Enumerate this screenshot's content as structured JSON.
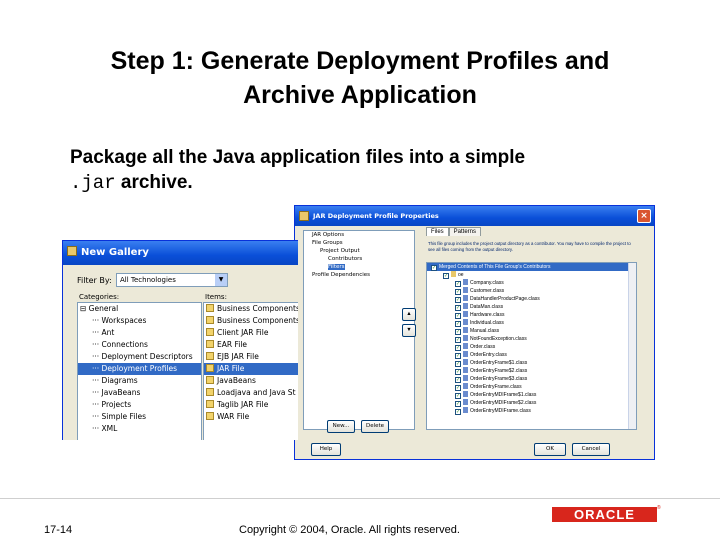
{
  "slide": {
    "title_line1": "Step 1: Generate Deployment Profiles and",
    "title_line2": "Archive Application",
    "body_prefix": "Package all the Java application files into a simple",
    "body_code": ".jar",
    "body_suffix": " archive.",
    "number": "17-14",
    "copyright": "Copyright © 2004, Oracle.  All rights reserved.",
    "logo": "ORACLE",
    "logo_mark": "®"
  },
  "gallery": {
    "title": "New Gallery",
    "filter_label": "Filter By:",
    "filter_value": "All Technologies",
    "categories_label": "Categories:",
    "items_label": "Items:",
    "categories": [
      {
        "label": "General",
        "prefix": "⊟ ",
        "selected": false
      },
      {
        "label": "Workspaces",
        "prefix": "··· ",
        "selected": false
      },
      {
        "label": "Ant",
        "prefix": "··· ",
        "selected": false
      },
      {
        "label": "Connections",
        "prefix": "··· ",
        "selected": false
      },
      {
        "label": "Deployment Descriptors",
        "prefix": "··· ",
        "selected": false
      },
      {
        "label": "Deployment Profiles",
        "prefix": "··· ",
        "selected": true
      },
      {
        "label": "Diagrams",
        "prefix": "··· ",
        "selected": false
      },
      {
        "label": "JavaBeans",
        "prefix": "··· ",
        "selected": false
      },
      {
        "label": "Projects",
        "prefix": "··· ",
        "selected": false
      },
      {
        "label": "Simple Files",
        "prefix": "··· ",
        "selected": false
      },
      {
        "label": "XML",
        "prefix": "··· ",
        "selected": false
      }
    ],
    "items": [
      {
        "label": "Business Components",
        "selected": false
      },
      {
        "label": "Business Components",
        "selected": false
      },
      {
        "label": "Client JAR File",
        "selected": false
      },
      {
        "label": "EAR File",
        "selected": false
      },
      {
        "label": "EJB JAR File",
        "selected": false
      },
      {
        "label": "JAR File",
        "selected": true
      },
      {
        "label": "JavaBeans",
        "selected": false
      },
      {
        "label": "Loadjava and Java St",
        "selected": false
      },
      {
        "label": "Taglib JAR File",
        "selected": false
      },
      {
        "label": "WAR File",
        "selected": false
      }
    ]
  },
  "jar_dialog": {
    "title": "JAR Deployment Profile Properties",
    "close": "×",
    "tree": [
      {
        "label": "JAR Options",
        "indent": 1,
        "selected": false
      },
      {
        "label": "File Groups",
        "indent": 1,
        "selected": false
      },
      {
        "label": "Project Output",
        "indent": 2,
        "selected": false
      },
      {
        "label": "Contributors",
        "indent": 3,
        "selected": false
      },
      {
        "label": "Filters",
        "indent": 3,
        "selected": true
      },
      {
        "label": "Profile Dependencies",
        "indent": 1,
        "selected": false
      }
    ],
    "tabs": [
      "Files",
      "Patterns"
    ],
    "description": "This file group includes the project output directory as a contributor. You may have to compile the project to see all files coming from the output directory.",
    "merged_header": "Merged Contents of This File Group's Contributors",
    "folder": "oe",
    "files": [
      "Company.class",
      "Customer.class",
      "DataHandlerProductPage.class",
      "DataMan.class",
      "Hardware.class",
      "Individual.class",
      "Manual.class",
      "NotFoundException.class",
      "Order.class",
      "OrderEntry.class",
      "OrderEntryFrame$1.class",
      "OrderEntryFrame$2.class",
      "OrderEntryFrame$3.class",
      "OrderEntryFrame.class",
      "OrderEntryMDIFrame$1.class",
      "OrderEntryMDIFrame$2.class",
      "OrderEntryMDIFrame.class"
    ],
    "new_button": "New...",
    "delete_button": "Delete",
    "help_button": "Help",
    "ok_button": "OK",
    "cancel_button": "Cancel"
  },
  "colors": {
    "titlebar": "#0a4fd8",
    "selection": "#316ac5",
    "dialog_bg": "#ece9d8",
    "oracle_red": "#d8261c"
  }
}
